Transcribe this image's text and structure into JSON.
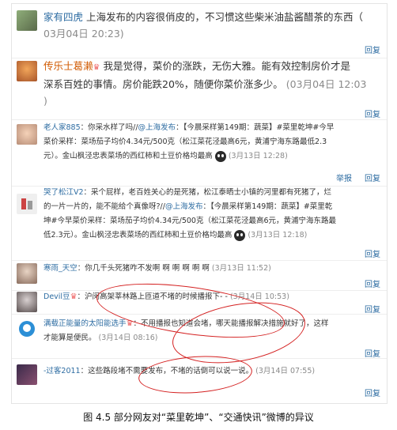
{
  "comments": [
    {
      "name": "家有四虎",
      "text": "上海发布的内容很俏皮的，不习惯这些柴米油盐酱醋茶的东西（",
      "time": "03月04日 20:23)",
      "reply": "回复"
    },
    {
      "name": "传乐士葛濑",
      "crown": "♛",
      "text1": "我是觉得，菜价的涨跌，无伤大雅。能有效控制房价才是",
      "text2": "深系百姓的事情。房价能跌20%，随便你菜价涨多少。",
      "time": "(03月04日 12:03",
      "close": ")",
      "reply": "回复"
    },
    {
      "name": "老人家885",
      "line1a": "：你采水样了吗//",
      "mention": "@上海发布",
      "line1b": "：【今晨采样第149期：蔬菜】#菜里乾坤#今早",
      "line2": "菜价采样：菜场茄子均价4.34元/500克（松江菜花泾最高6元，黄浦宁海东路最低2.3",
      "line3": "元）。金山枫泾忠表菜场的西红柿和土豆价格均最高",
      "time": "(3月13日 12:28)",
      "report": "举报",
      "reply": "回复"
    },
    {
      "name": "哭了松江V2",
      "line1": "：采个屁样，老百姓关心的是死猪，松江泰晒士小镇的河里都有死猪了，烂",
      "line2a": "的一片一片的，能不能给个真像呀?//",
      "mention": "@上海发布",
      "line2b": "：【今晨采样第149期：蔬菜】#菜里乾",
      "line3": "坤#今早菜价采样：菜场茄子均价4.34元/500克（松江菜花泾最高6元，黄浦宁海东路最",
      "line4": "低2.3元）。金山枫泾忠表菜场的西红柿和土豆价格均最高",
      "time": "(3月13日 12:18)",
      "reply": "回复"
    },
    {
      "name": "寒雨_天空",
      "text": "：你几千头死猪咋不发啊 啊 啊 啊 啊 啊",
      "time": "(3月13日 11:52)",
      "reply": "回复"
    },
    {
      "name": "Devil豆",
      "crown": "♛",
      "text": "：沪闵高架莘林路上匝道不堵的时候播报下- -",
      "time": "(3月14日 10:53)",
      "reply": "回复"
    },
    {
      "name": "满载正能量的太阳能选手",
      "crown": "♛",
      "text1": "：不用播报也知道会堵，哪天能播报解决措施就好了，这样",
      "text2": "才能算是便民。",
      "time": "(3月14日 08:16)",
      "reply": "回复"
    },
    {
      "name": "-过客2011",
      "text": "：这些路段堵不需要发布，不堵的话倒可以说一说。",
      "time": "(3月14日 07:55)",
      "reply": "回复"
    }
  ],
  "caption": "图 4.5 部分网友对“菜里乾坤”、“交通快讯”微博的异议"
}
